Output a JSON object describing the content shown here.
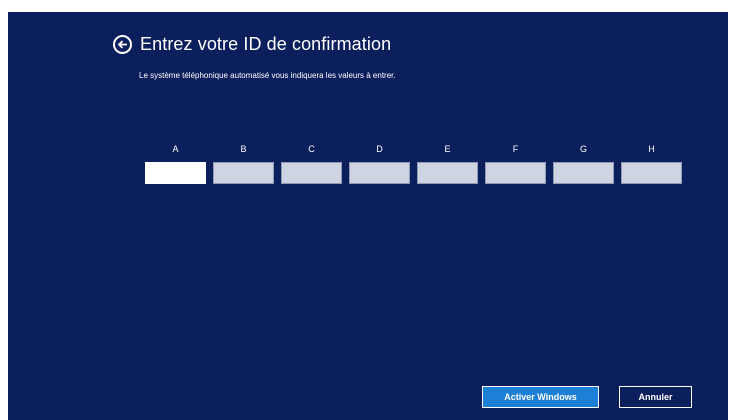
{
  "header": {
    "title": "Entrez votre ID de confirmation",
    "back_icon": "back-arrow-circle-icon"
  },
  "subtitle": "Le système téléphonique automatisé vous indiquera les valeurs à entrer.",
  "fields": [
    {
      "label": "A",
      "value": ""
    },
    {
      "label": "B",
      "value": ""
    },
    {
      "label": "C",
      "value": ""
    },
    {
      "label": "D",
      "value": ""
    },
    {
      "label": "E",
      "value": ""
    },
    {
      "label": "F",
      "value": ""
    },
    {
      "label": "G",
      "value": ""
    },
    {
      "label": "H",
      "value": ""
    }
  ],
  "buttons": {
    "activate": "Activer Windows",
    "cancel": "Annuler"
  },
  "colors": {
    "background": "#0c1f5d",
    "primary_button": "#1e7fd6",
    "input_inactive": "#cfd4e2"
  }
}
